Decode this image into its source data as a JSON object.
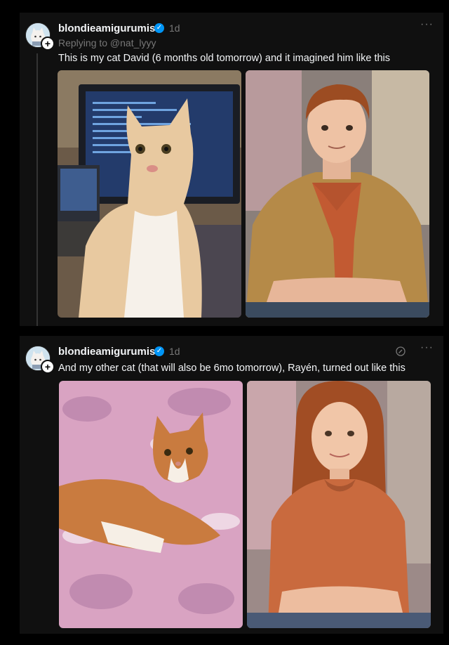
{
  "posts": [
    {
      "username": "blondieamigurumis",
      "time": "1d",
      "replying_to": "Replying to @nat_lyyy",
      "caption": "This is my cat David (6 months old tomorrow) and it imagined him like this",
      "more_label": "···",
      "images": [
        {
          "icon": "photo-cat-at-computer"
        },
        {
          "icon": "photo-young-man-jacket"
        }
      ]
    },
    {
      "username": "blondieamigurumis",
      "time": "1d",
      "caption": "And my other cat (that will also be 6mo tomorrow), Rayén, turned out like this",
      "more_label": "···",
      "images": [
        {
          "icon": "photo-cat-on-blanket"
        },
        {
          "icon": "photo-young-woman-redhead"
        }
      ]
    }
  ],
  "colors": {
    "background": "#000000",
    "card": "#101010",
    "text": "#f3f5f7",
    "muted": "#777777",
    "verified": "#0095f6"
  }
}
